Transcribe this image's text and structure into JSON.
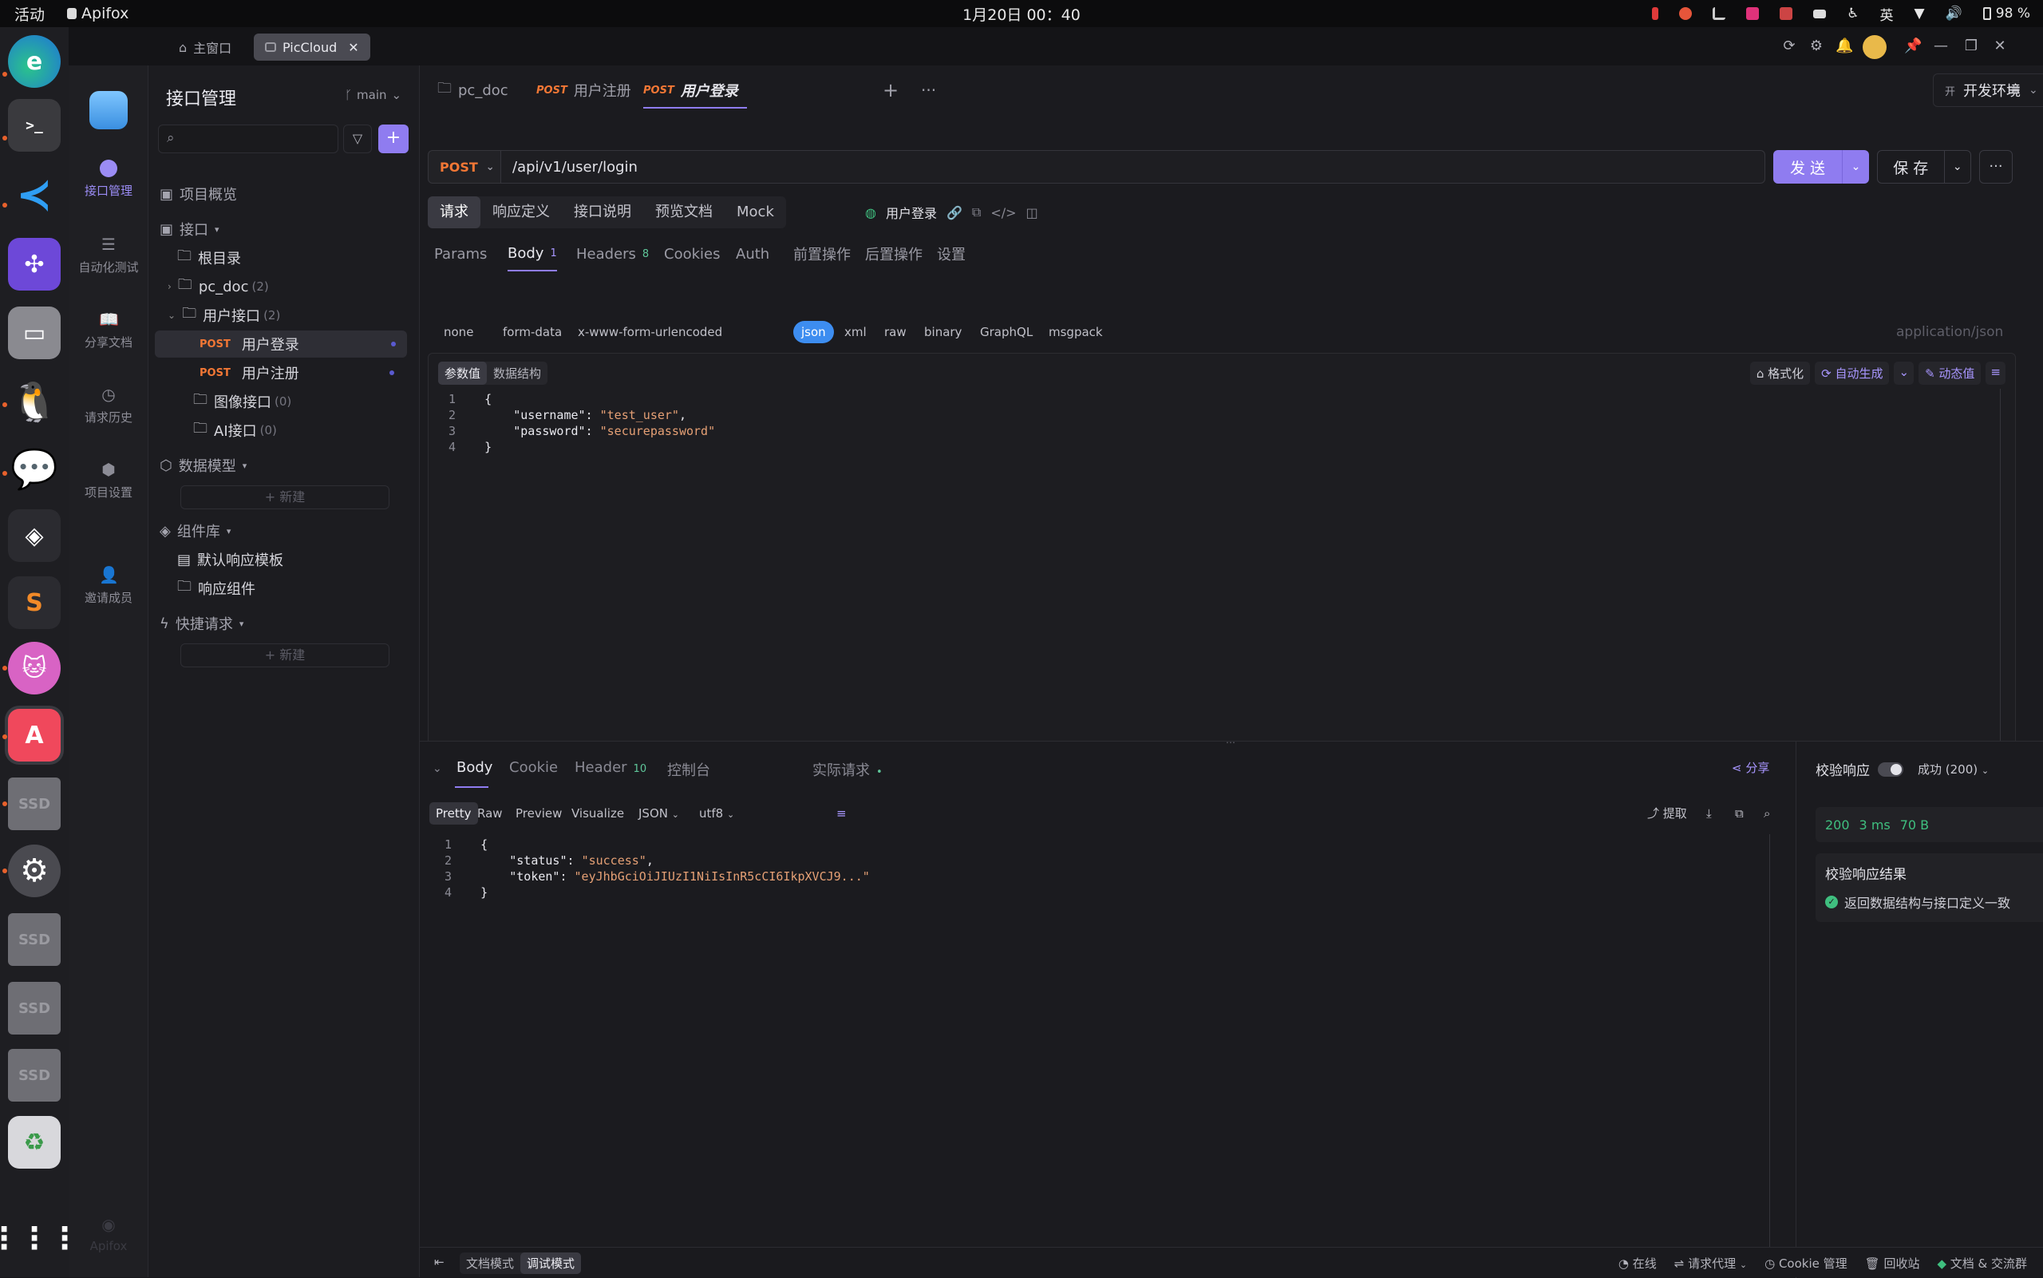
{
  "system_bar": {
    "activities": "活动",
    "app_name": "Apifox",
    "clock": "1月20日  00：40",
    "input_method": "英",
    "battery": "98 %"
  },
  "window_tabs": [
    {
      "label": "主窗口"
    },
    {
      "label": "PicCloud"
    }
  ],
  "rail": {
    "items": [
      {
        "label": "接口管理",
        "icon": "api-icon"
      },
      {
        "label": "自动化测试",
        "icon": "automation-icon"
      },
      {
        "label": "分享文档",
        "icon": "share-doc-icon"
      },
      {
        "label": "请求历史",
        "icon": "history-icon"
      },
      {
        "label": "项目设置",
        "icon": "settings-icon"
      },
      {
        "label": "邀请成员",
        "icon": "invite-icon"
      }
    ],
    "brand": "Apifox"
  },
  "left_panel": {
    "title": "接口管理",
    "branch": "main",
    "overview": "项目概览",
    "interfaces": "接口",
    "root": "根目录",
    "folders": [
      {
        "name": "pc_doc",
        "count": "(2)"
      },
      {
        "name": "用户接口",
        "count": "(2)"
      },
      {
        "name": "图像接口",
        "count": "(0)"
      },
      {
        "name": "AI接口",
        "count": "(0)"
      }
    ],
    "endpoints": [
      {
        "method": "POST",
        "name": "用户登录"
      },
      {
        "method": "POST",
        "name": "用户注册"
      }
    ],
    "data_models": "数据模型",
    "new_label": "+ 新建",
    "components": "组件库",
    "default_template": "默认响应模板",
    "response_component": "响应组件",
    "quick_request": "快捷请求"
  },
  "doc_tabs": [
    {
      "method": "",
      "label": "pc_doc"
    },
    {
      "method": "POST",
      "label": "用户注册"
    },
    {
      "method": "POST",
      "label": "用户登录"
    }
  ],
  "environment": "开发环境",
  "request": {
    "method": "POST",
    "url": "/api/v1/user/login",
    "send": "发 送",
    "save": "保 存",
    "segments": [
      "请求",
      "响应定义",
      "接口说明",
      "预览文档",
      "Mock"
    ],
    "api_name": "用户登录",
    "subtabs": [
      {
        "label": "Params",
        "badge": ""
      },
      {
        "label": "Body",
        "badge": "1"
      },
      {
        "label": "Headers",
        "badge": "8"
      },
      {
        "label": "Cookies",
        "badge": ""
      },
      {
        "label": "Auth",
        "badge": ""
      },
      {
        "label": "前置操作",
        "badge": ""
      },
      {
        "label": "后置操作",
        "badge": ""
      },
      {
        "label": "设置",
        "badge": ""
      }
    ],
    "body_types": [
      "none",
      "form-data",
      "x-www-form-urlencoded",
      "json",
      "xml",
      "raw",
      "binary",
      "GraphQL",
      "msgpack"
    ],
    "content_type": "application/json",
    "param_value": "参数值",
    "data_structure": "数据结构",
    "format": "格式化",
    "auto_generate": "自动生成",
    "dynamic_value": "动态值",
    "body_lines": [
      {
        "no": "1",
        "text": "{"
      },
      {
        "no": "2",
        "key": "\"username\"",
        "val": "\"test_user\"",
        "tail": ","
      },
      {
        "no": "3",
        "key": "\"password\"",
        "val": "\"securepassword\"",
        "tail": ""
      },
      {
        "no": "4",
        "text": "}"
      }
    ]
  },
  "response": {
    "tabs": [
      {
        "label": "Body",
        "badge": ""
      },
      {
        "label": "Cookie",
        "badge": ""
      },
      {
        "label": "Header",
        "badge": "10"
      },
      {
        "label": "控制台",
        "badge": ""
      },
      {
        "label": "实际请求",
        "badge": "•"
      }
    ],
    "share": "分享",
    "view_modes": [
      "Pretty",
      "Raw",
      "Preview",
      "Visualize"
    ],
    "format": "JSON",
    "encoding": "utf8",
    "extract": "提取",
    "lines": [
      {
        "no": "1",
        "text": "{"
      },
      {
        "no": "2",
        "key": "\"status\"",
        "val": "\"success\"",
        "tail": ","
      },
      {
        "no": "3",
        "key": "\"token\"",
        "val": "\"eyJhbGciOiJIUzI1NiIsInR5cCI6IkpXVCJ9...\"",
        "tail": ""
      },
      {
        "no": "4",
        "text": "}"
      }
    ],
    "validate_label": "校验响应",
    "validate_status": "成功 (200)",
    "status_code": "200",
    "time": "3 ms",
    "size": "70 B",
    "result_title": "校验响应结果",
    "result_text": "返回数据结构与接口定义一致"
  },
  "statusbar": {
    "doc_mode": "文档模式",
    "debug_mode": "调试模式",
    "online": "在线",
    "proxy": "请求代理",
    "cookie": "Cookie 管理",
    "trash": "回收站",
    "community": "文档 & 交流群"
  },
  "colors": {
    "accent": "#8f7cf0",
    "post": "#f27735",
    "success": "#3fbf7f",
    "json_chip": "#3d8df0"
  }
}
